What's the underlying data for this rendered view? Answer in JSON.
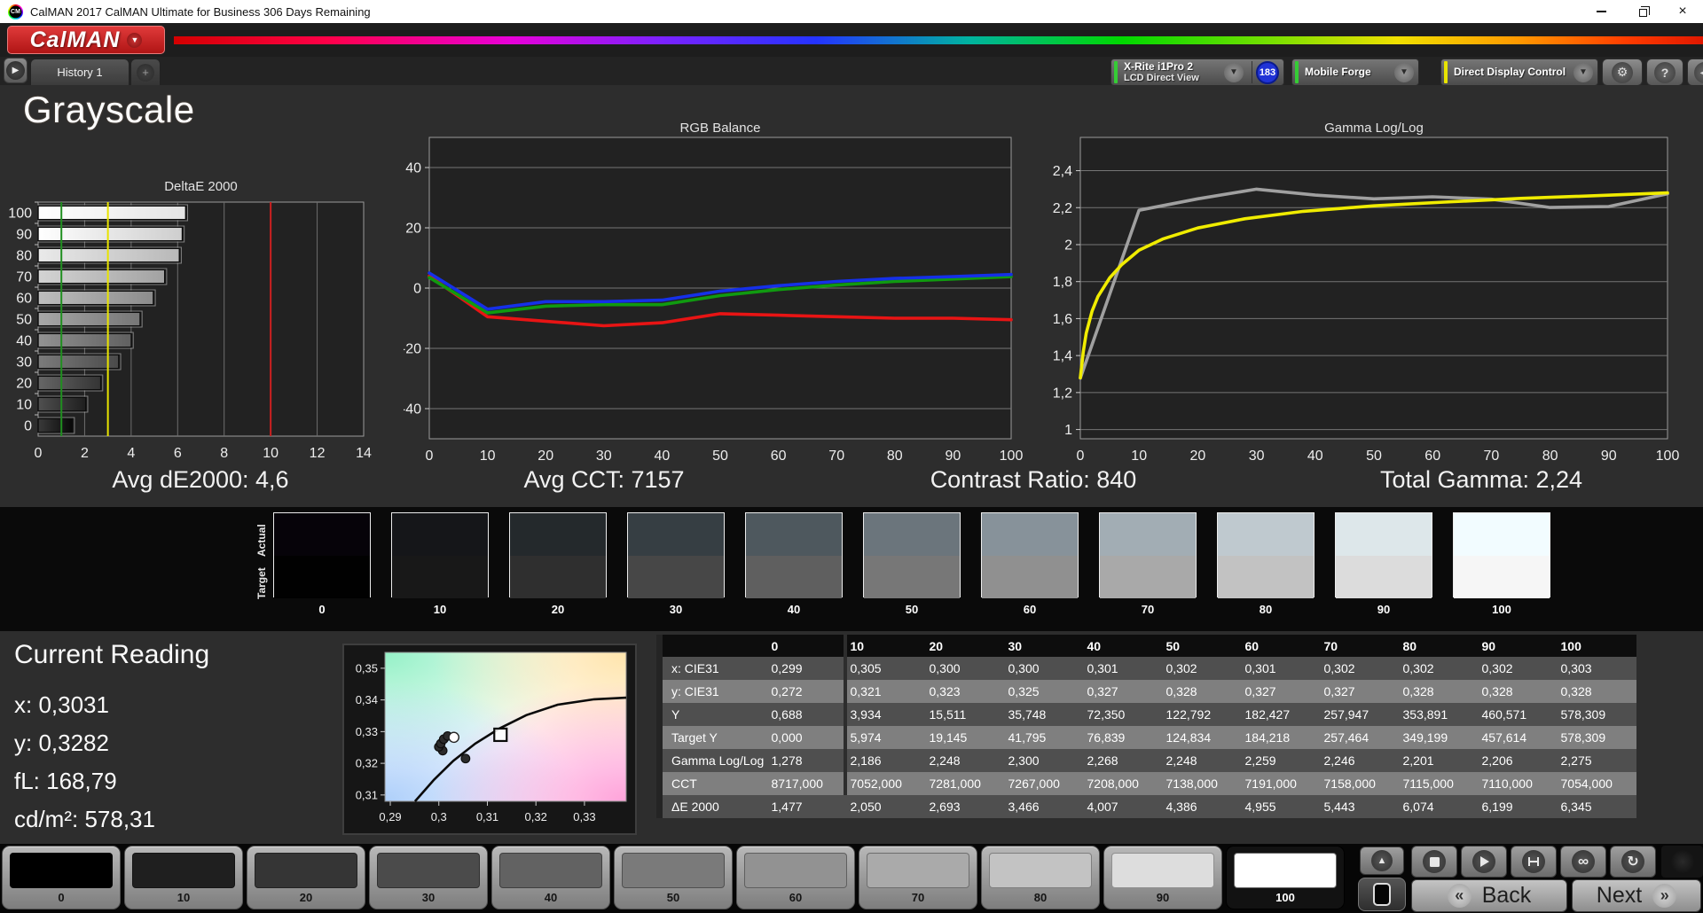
{
  "window": {
    "title": "CalMAN 2017 CalMAN Ultimate for Business 306 Days Remaining"
  },
  "brand": {
    "logo_text": "CalMAN"
  },
  "tab_bar": {
    "history_tab": "History 1",
    "add_tab": "+"
  },
  "toolbar": {
    "meter_button": {
      "line1": "X-Rite i1Pro 2",
      "line2": "LCD Direct View",
      "badge": "183",
      "accent": "#35cc35"
    },
    "source_button": {
      "label": "Mobile Forge",
      "accent": "#35cc35"
    },
    "display_button": {
      "label": "Direct Display Control",
      "accent": "#e8e400"
    },
    "gear_icon": "⚙",
    "help_icon": "?",
    "collapse_icon": "◀"
  },
  "page": {
    "title": "Grayscale"
  },
  "stats": {
    "avg_de": "Avg dE2000: 4,6",
    "avg_cct": "Avg CCT: 7157",
    "contrast": "Contrast Ratio: 840",
    "total_gamma": "Total Gamma: 2,24"
  },
  "swatch_strip": {
    "actual_label": "Actual",
    "target_label": "Target",
    "levels": [
      "0",
      "10",
      "20",
      "30",
      "40",
      "50",
      "60",
      "70",
      "80",
      "90",
      "100"
    ],
    "actual_colors": [
      "#060309",
      "#151619",
      "#24292c",
      "#363e43",
      "#4e585e",
      "#6b757c",
      "#87929a",
      "#a2adb4",
      "#bfc9cf",
      "#dde7ea",
      "#f2fcff"
    ],
    "target_colors": [
      "#010101",
      "#181818",
      "#2f2f2f",
      "#474747",
      "#5f5f5f",
      "#777777",
      "#909090",
      "#a9a9a9",
      "#c2c2c2",
      "#dcdcdc",
      "#f6f6f6"
    ]
  },
  "current_reading": {
    "title": "Current Reading",
    "lines": [
      "x: 0,3031",
      "y: 0,3282",
      "fL: 168,79",
      "cd/m²: 578,31"
    ]
  },
  "table": {
    "columns": [
      "",
      "0",
      "10",
      "20",
      "30",
      "40",
      "50",
      "60",
      "70",
      "80",
      "90",
      "100"
    ],
    "rows": [
      {
        "label": "x: CIE31",
        "values": [
          "0,299",
          "0,305",
          "0,300",
          "0,300",
          "0,301",
          "0,302",
          "0,301",
          "0,302",
          "0,302",
          "0,302",
          "0,303"
        ]
      },
      {
        "label": "y: CIE31",
        "values": [
          "0,272",
          "0,321",
          "0,323",
          "0,325",
          "0,327",
          "0,328",
          "0,327",
          "0,327",
          "0,328",
          "0,328",
          "0,328"
        ]
      },
      {
        "label": "Y",
        "values": [
          "0,688",
          "3,934",
          "15,511",
          "35,748",
          "72,350",
          "122,792",
          "182,427",
          "257,947",
          "353,891",
          "460,571",
          "578,309"
        ]
      },
      {
        "label": "Target Y",
        "values": [
          "0,000",
          "5,974",
          "19,145",
          "41,795",
          "76,839",
          "124,834",
          "184,218",
          "257,464",
          "349,199",
          "457,614",
          "578,309"
        ]
      },
      {
        "label": "Gamma Log/Log",
        "values": [
          "1,278",
          "2,186",
          "2,248",
          "2,300",
          "2,268",
          "2,248",
          "2,259",
          "2,246",
          "2,201",
          "2,206",
          "2,275"
        ]
      },
      {
        "label": "CCT",
        "values": [
          "8717,000",
          "7052,000",
          "7281,000",
          "7267,000",
          "7208,000",
          "7138,000",
          "7191,000",
          "7158,000",
          "7115,000",
          "7110,000",
          "7054,000"
        ]
      },
      {
        "label": "ΔE 2000",
        "values": [
          "1,477",
          "2,050",
          "2,693",
          "3,466",
          "4,007",
          "4,386",
          "4,955",
          "5,443",
          "6,074",
          "6,199",
          "6,345"
        ]
      }
    ]
  },
  "bottom_bar": {
    "patch_labels": [
      "0",
      "10",
      "20",
      "30",
      "40",
      "50",
      "60",
      "70",
      "80",
      "90",
      "100"
    ],
    "patch_colors": [
      "#000000",
      "#1f1f1f",
      "#353535",
      "#4b4b4b",
      "#626262",
      "#7a7a7a",
      "#929292",
      "#aaaaaa",
      "#c3c3c3",
      "#dddddd",
      "#ffffff"
    ],
    "selected_patch": "100",
    "back_label": "Back",
    "next_label": "Next",
    "back_arrow": "«",
    "next_arrow": "»"
  },
  "chart_data": [
    {
      "type": "bar",
      "orientation": "horizontal",
      "title": "DeltaE 2000",
      "categories": [
        0,
        10,
        20,
        30,
        40,
        50,
        60,
        70,
        80,
        90,
        100
      ],
      "values": [
        1.477,
        2.05,
        2.693,
        3.466,
        4.007,
        4.386,
        4.955,
        5.443,
        6.074,
        6.199,
        6.345
      ],
      "xlim": [
        0,
        14
      ],
      "xticks": [
        0,
        2,
        4,
        6,
        8,
        10,
        12,
        14
      ],
      "reference_lines": [
        {
          "x": 1,
          "color": "#1f8f1f"
        },
        {
          "x": 3,
          "color": "#e8e400"
        },
        {
          "x": 10,
          "color": "#cc2020"
        }
      ],
      "note": "bars shaded with the gray level they represent; top bar = level 100"
    },
    {
      "type": "line",
      "title": "RGB Balance",
      "x": [
        0,
        10,
        20,
        30,
        40,
        50,
        60,
        70,
        80,
        90,
        100
      ],
      "xlim": [
        0,
        100
      ],
      "series": [
        {
          "name": "Red",
          "color": "#e81414",
          "values": [
            4,
            -9.5,
            -11,
            -12.5,
            -11.5,
            -8.5,
            -9,
            -9.5,
            -10,
            -10,
            -10.5
          ]
        },
        {
          "name": "Green",
          "color": "#109a10",
          "values": [
            3.5,
            -8.2,
            -6,
            -5.5,
            -5.5,
            -2.5,
            -0.5,
            1,
            2.2,
            3,
            3.8
          ]
        },
        {
          "name": "Blue",
          "color": "#1530e8",
          "values": [
            5,
            -7,
            -4.5,
            -4.5,
            -4,
            -1,
            0.8,
            2.2,
            3.2,
            3.8,
            4.5
          ]
        }
      ],
      "ylim": [
        -50,
        50
      ],
      "yticks": [
        40,
        20,
        0,
        -20,
        -40
      ],
      "ytick_labels": [
        "40",
        "20",
        "0",
        "-20",
        "-40"
      ],
      "xticks": [
        0,
        10,
        20,
        30,
        40,
        50,
        60,
        70,
        80,
        90,
        100
      ]
    },
    {
      "type": "line",
      "title": "Gamma Log/Log",
      "x": [
        0,
        10,
        20,
        30,
        40,
        50,
        60,
        70,
        80,
        90,
        100
      ],
      "xlim": [
        0,
        100
      ],
      "series": [
        {
          "name": "Measured Gamma",
          "color": "#a0a0a0",
          "values": [
            1.278,
            2.186,
            2.248,
            2.3,
            2.268,
            2.248,
            2.259,
            2.246,
            2.201,
            2.206,
            2.275
          ]
        },
        {
          "name": "Target Gamma",
          "color": "#f0ec00",
          "x": [
            0,
            0.5,
            1,
            2,
            3,
            5,
            7,
            10,
            14,
            20,
            28,
            38,
            50,
            62,
            75,
            88,
            100
          ],
          "values": [
            1.28,
            1.42,
            1.52,
            1.64,
            1.72,
            1.82,
            1.89,
            1.97,
            2.03,
            2.09,
            2.14,
            2.18,
            2.21,
            2.23,
            2.25,
            2.265,
            2.28
          ]
        }
      ],
      "ylim": [
        0.95,
        2.58
      ],
      "yticks": [
        1,
        1.2,
        1.4,
        1.6,
        1.8,
        2,
        2.2,
        2.4
      ],
      "ytick_labels": [
        "1",
        "1,2",
        "1,4",
        "1,6",
        "1,8",
        "2",
        "2,2",
        "2,4"
      ],
      "xticks": [
        0,
        10,
        20,
        30,
        40,
        50,
        60,
        70,
        80,
        90,
        100
      ]
    },
    {
      "type": "scatter",
      "title": "CIE chromaticity detail",
      "xlim": [
        0.2889,
        0.3386
      ],
      "ylim": [
        0.308,
        0.355
      ],
      "xticks": [
        0.29,
        0.3,
        0.31,
        0.32,
        0.33
      ],
      "xtick_labels": [
        "0,29",
        "0,3",
        "0,31",
        "0,32",
        "0,33"
      ],
      "yticks": [
        0.31,
        0.32,
        0.33,
        0.34,
        0.35
      ],
      "ytick_labels": [
        "0,31",
        "0,32",
        "0,33",
        "0,34",
        "0,35"
      ],
      "locus_curve": [
        [
          0.2951,
          0.308
        ],
        [
          0.299,
          0.3148
        ],
        [
          0.303,
          0.3208
        ],
        [
          0.3075,
          0.3262
        ],
        [
          0.3125,
          0.331
        ],
        [
          0.318,
          0.3352
        ],
        [
          0.3245,
          0.3385
        ],
        [
          0.332,
          0.3402
        ],
        [
          0.3386,
          0.3407
        ]
      ],
      "points": [
        {
          "x": 0.3008,
          "y": 0.324,
          "style": "dark"
        },
        {
          "x": 0.3,
          "y": 0.3252,
          "style": "dark"
        },
        {
          "x": 0.3004,
          "y": 0.3262,
          "style": "dark"
        },
        {
          "x": 0.301,
          "y": 0.3276,
          "style": "dark"
        },
        {
          "x": 0.3018,
          "y": 0.3286,
          "style": "dark"
        },
        {
          "x": 0.3055,
          "y": 0.3215,
          "style": "dark"
        },
        {
          "x": 0.3031,
          "y": 0.3282,
          "style": "current"
        }
      ],
      "target_marker": {
        "x": 0.3127,
        "y": 0.329
      }
    }
  ]
}
